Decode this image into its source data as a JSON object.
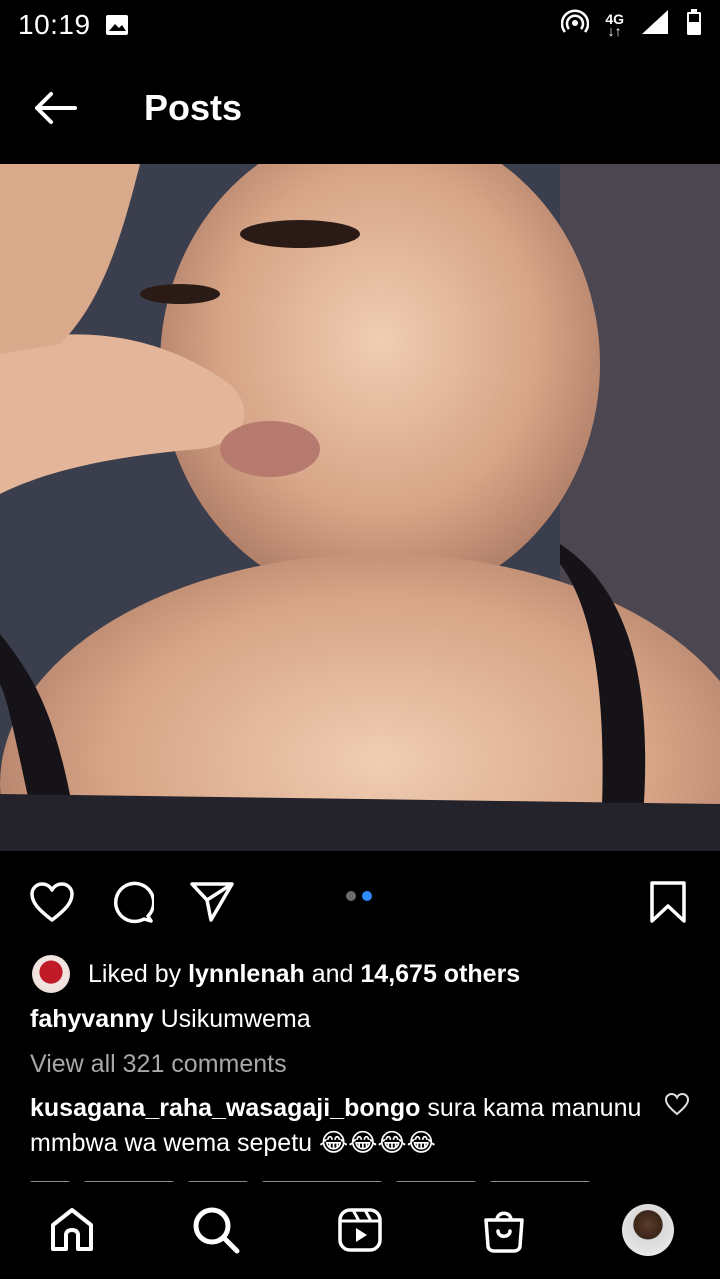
{
  "status_bar": {
    "time": "10:19",
    "network": "4G"
  },
  "app_bar": {
    "title": "Posts"
  },
  "post": {
    "likes": {
      "prefix": "Liked by",
      "user": "lynnlenah",
      "joiner": "and",
      "others": "14,675 others"
    },
    "caption": {
      "username": "fahyvanny",
      "text": "Usikumwema"
    },
    "view_all_comments": "View all 321 comments",
    "comment": {
      "username": "kusagana_raha_wasagaji_bongo",
      "text": "sura kama manunu mmbwa wa wema sepetu 😂😂😂😂"
    },
    "carousel": {
      "current": 2,
      "total": 2
    }
  },
  "icons": {
    "like": "heart-icon",
    "comment": "comment-icon",
    "share": "send-icon",
    "save": "bookmark-icon",
    "home": "home-icon",
    "search": "search-icon",
    "reels": "reels-icon",
    "shop": "shop-icon"
  },
  "colors": {
    "accent": "#2d8cff",
    "background": "#000000",
    "muted_text": "#a8a8a8"
  }
}
